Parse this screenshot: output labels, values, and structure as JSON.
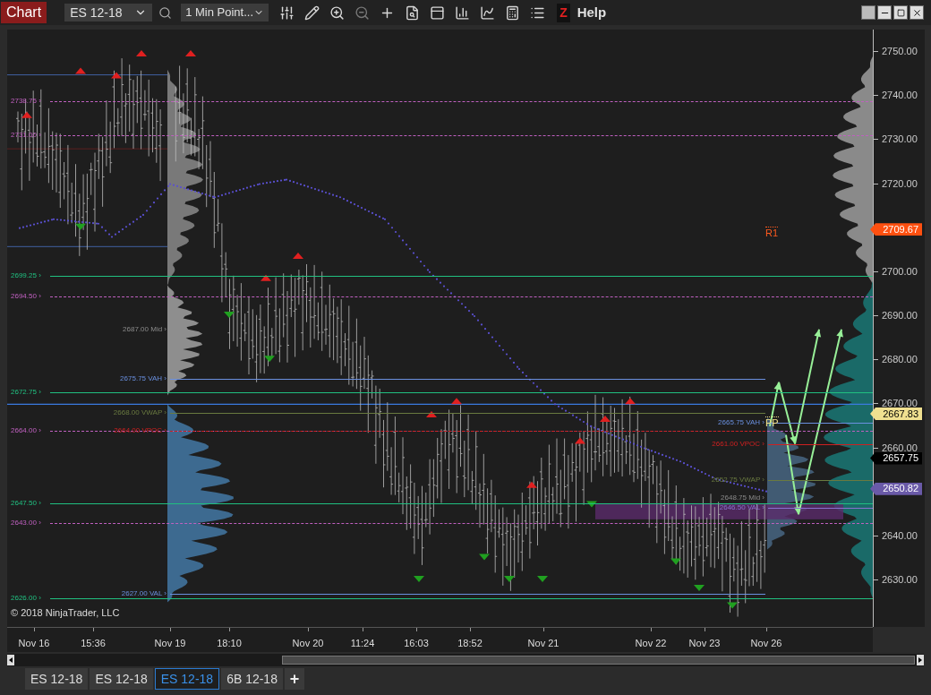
{
  "toolbar": {
    "title": "Chart",
    "instrument": "ES 12-18",
    "interval": "1 Min Point...",
    "z_label": "Z",
    "help": "Help"
  },
  "levels": [
    {
      "label": "2738.75 ›",
      "kind": "session",
      "color": "#c060c0",
      "dashed": true
    },
    {
      "label": "2731.00 ›",
      "kind": "session",
      "color": "#c060c0",
      "dashed": true
    },
    {
      "label": "2699.25 ›",
      "kind": "session",
      "color": "#20c080",
      "dashed": false
    },
    {
      "label": "2694.50 ›",
      "kind": "session",
      "color": "#c060c0",
      "dashed": true
    },
    {
      "label": "2672.75 ›",
      "kind": "session",
      "color": "#20c080",
      "dashed": false
    },
    {
      "label": "2664.00 ›",
      "kind": "session",
      "color": "#c060c0",
      "dashed": true
    },
    {
      "label": "2647.50 ›",
      "kind": "session",
      "color": "#20c080",
      "dashed": false
    },
    {
      "label": "2643.00 ›",
      "kind": "session",
      "color": "#c060c0",
      "dashed": true
    },
    {
      "label": "2626.00 ›",
      "kind": "session",
      "color": "#20c080",
      "dashed": false
    },
    {
      "label": "2687.00 Mid ›",
      "kind": "mid_left"
    },
    {
      "label": "2675.75 VAH ›",
      "kind": "profile_left",
      "color": "#6a90e0",
      "dashed": false
    },
    {
      "label": "2668.00 VWAP ›",
      "kind": "profile_left",
      "color": "#6a7a40",
      "dashed": false
    },
    {
      "label": "2664.00 VPOC ›",
      "kind": "profile_left",
      "color": "#d02020",
      "dashed": true
    },
    {
      "label": "2627.00 VAL ›",
      "kind": "profile_left",
      "color": "#6a90e0",
      "dashed": false
    },
    {
      "label": "2665.75 VAH ›",
      "kind": "profile_right",
      "color": "#6a90e0",
      "dashed": false
    },
    {
      "label": "2661.00 VPOC ›",
      "kind": "profile_right",
      "color": "#d02020",
      "dashed": false
    },
    {
      "label": "2652.75 VWAP ›",
      "kind": "profile_right",
      "color": "#6a7a40",
      "dashed": false
    },
    {
      "label": "2648.75 Mid ›",
      "kind": "mid_right"
    },
    {
      "label": "2646.50 VAL ›",
      "kind": "profile_right",
      "color": "#8a70d0",
      "dashed": false
    }
  ],
  "pivots": [
    {
      "label": "R1",
      "color": "#ff5a1e"
    },
    {
      "label": "PP",
      "color": "#f0e08a"
    }
  ],
  "copyright": "© 2018 NinjaTrader, LLC",
  "price_axis": [
    "2750.00",
    "2740.00",
    "2730.00",
    "2720.00",
    "2700.00",
    "2690.00",
    "2680.00",
    "2670.00",
    "2660.00",
    "2640.00",
    "2630.00"
  ],
  "price_tags": [
    {
      "label": "2709.67",
      "color": "#ff5010"
    },
    {
      "label": "2667.83",
      "color": "#f0e090"
    },
    {
      "label": "2657.75",
      "color": "#000000"
    },
    {
      "label": "2650.82",
      "color": "#6a5aa8"
    }
  ],
  "time_axis": [
    "Nov 16",
    "15:36",
    "Nov 19",
    "18:10",
    "Nov 20",
    "11:24",
    "16:03",
    "18:52",
    "Nov 21",
    "Nov 22",
    "Nov 23",
    "Nov 26"
  ],
  "tabs": [
    {
      "label": "ES 12-18",
      "selected": false
    },
    {
      "label": "ES 12-18",
      "selected": false
    },
    {
      "label": "ES 12-18",
      "selected": true
    },
    {
      "label": "6B 12-18",
      "selected": false
    }
  ],
  "add_tab": "+"
}
